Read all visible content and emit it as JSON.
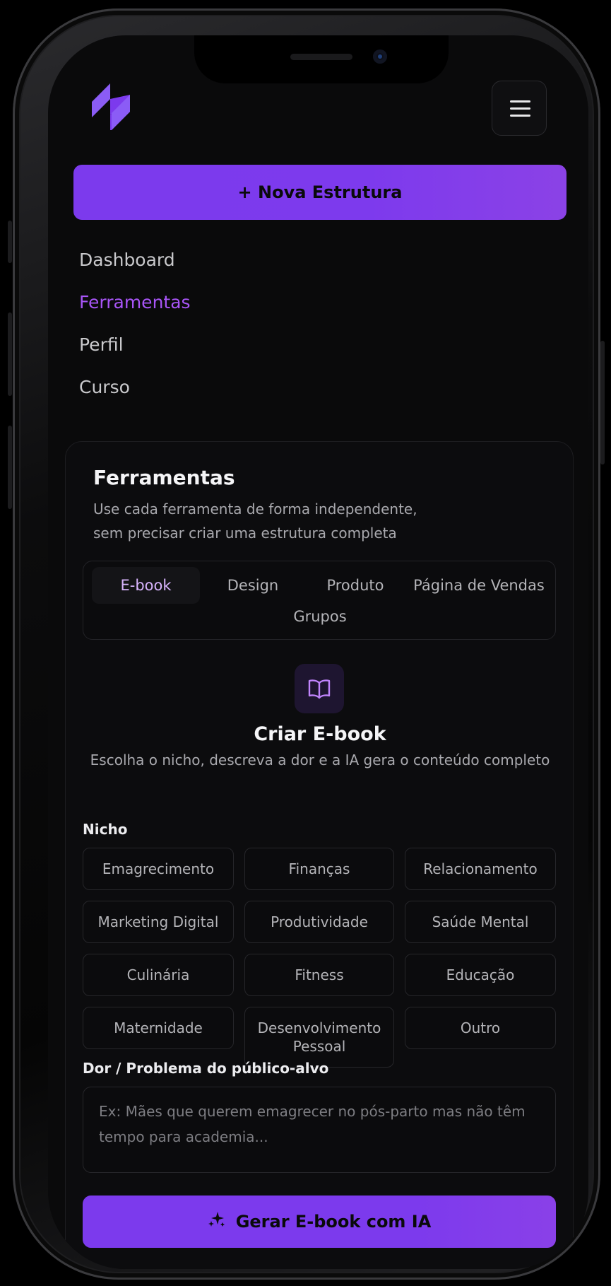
{
  "header": {
    "logo_icon": "brand-logo-icon",
    "menu_icon": "hamburger-menu-icon",
    "new_structure_label": "+ Nova Estrutura"
  },
  "nav": {
    "items": [
      {
        "label": "Dashboard",
        "active": false
      },
      {
        "label": "Ferramentas",
        "active": true
      },
      {
        "label": "Perfil",
        "active": false
      },
      {
        "label": "Curso",
        "active": false
      }
    ]
  },
  "tools": {
    "title": "Ferramentas",
    "subtitle_line1": "Use cada ferramenta de forma independente,",
    "subtitle_line2": "sem precisar criar uma estrutura completa",
    "tabs": [
      "E-book",
      "Design",
      "Produto",
      "Página de Vendas",
      "Grupos"
    ],
    "active_tab": "E-book"
  },
  "ebook": {
    "icon": "open-book-icon",
    "title": "Criar E-book",
    "subtitle": "Escolha o nicho, descreva a dor e a IA gera o conteúdo completo",
    "niche_label": "Nicho",
    "niches": [
      "Emagrecimento",
      "Finanças",
      "Relacionamento",
      "Marketing Digital",
      "Produtividade",
      "Saúde Mental",
      "Culinária",
      "Fitness",
      "Educação",
      "Maternidade",
      "Desenvolvimento Pessoal",
      "Outro"
    ],
    "pain_label": "Dor / Problema do público-alvo",
    "pain_placeholder": "Ex: Mães que querem emagrecer no pós-parto mas não têm tempo para academia...",
    "generate_label": "Gerar E-book com IA",
    "generate_icon": "sparkles-icon"
  },
  "colors": {
    "accent": "#7c3aed",
    "accent_text": "#a855f7",
    "background": "#0a0a0b"
  }
}
